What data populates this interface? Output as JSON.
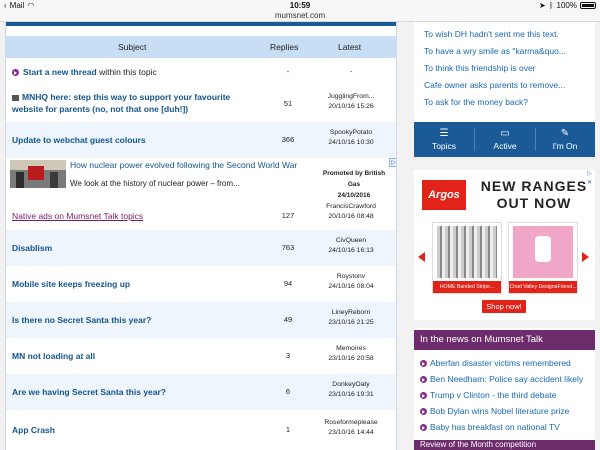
{
  "statusbar": {
    "back_label": "Mail",
    "time": "10:59",
    "battery": "100%"
  },
  "browser": {
    "url": "mumsnet.com"
  },
  "table": {
    "headers": {
      "subject": "Subject",
      "replies": "Replies",
      "latest": "Latest"
    },
    "start_thread": {
      "link": "Start a new thread",
      "suffix": "within this topic",
      "replies": "-",
      "latest": "-"
    },
    "rows": [
      {
        "subject_line1": "MNHQ here: step this way to support your favourite",
        "subject_line2": "website for parents (no, not that one [duh!])",
        "replies": "51",
        "latest_user": "JugglingFrom...",
        "latest_time": "20/10/16 15:26"
      },
      {
        "subject_line1": "Update to webchat guest colours",
        "subject_line2": "",
        "replies": "366",
        "latest_user": "SpookyPotato",
        "latest_time": "24/10/16 10:30"
      },
      {
        "subject_line1": "Native ads on Mumsnet Talk topics",
        "subject_line2": "",
        "replies": "127",
        "latest_user": "FrancisCrawford",
        "latest_time": "20/10/16 08:48"
      },
      {
        "subject_line1": "Disablism",
        "subject_line2": "",
        "replies": "763",
        "latest_user": "CivQueen",
        "latest_time": "24/10/16 16:13"
      },
      {
        "subject_line1": "Mobile site keeps freezing up",
        "subject_line2": "",
        "replies": "94",
        "latest_user": "Roystonv",
        "latest_time": "24/10/16 08:04"
      },
      {
        "subject_line1": "Is there no Secret Santa this year?",
        "subject_line2": "",
        "replies": "49",
        "latest_user": "LineyReborn",
        "latest_time": "23/10/16 21:25"
      },
      {
        "subject_line1": "MN not loading at all",
        "subject_line2": "",
        "replies": "3",
        "latest_user": "Memoires",
        "latest_time": "23/10/16 20:58"
      },
      {
        "subject_line1": "Are we having Secret Santa this year?",
        "subject_line2": "",
        "replies": "6",
        "latest_user": "DonkeyOaty",
        "latest_time": "23/10/16 19:31"
      },
      {
        "subject_line1": "App Crash",
        "subject_line2": "",
        "replies": "1",
        "latest_user": "Roseformeplease",
        "latest_time": "23/10/16 14:44"
      }
    ],
    "native_ad": {
      "headline": "How nuclear power evolved following the Second World War",
      "text": "We look at the history of nuclear power – from...",
      "promoted_by": "Promoted by",
      "sponsor": "British Gas",
      "date": "24/10/2016",
      "badge": "▷"
    }
  },
  "sidebar": {
    "links": [
      "To wish DH hadn't sent me this text.",
      "To have a wry smile as \"karma&quo...",
      "To think this friendship is over",
      "Cafe owner asks parents to remove...",
      "To ask for the money back?"
    ],
    "tabs": [
      {
        "label": "Topics",
        "icon": "list-icon"
      },
      {
        "label": "Active",
        "icon": "speech-bubble-icon"
      },
      {
        "label": "I'm On",
        "icon": "pin-icon"
      }
    ],
    "argos_ad": {
      "logo": "Argos",
      "headline_line1": "NEW RANGES",
      "headline_line2": "OUT NOW",
      "product1": "HOME Banded Stripe...",
      "product2": "Chad Valley DesignaFriend...",
      "cta": "Shop now!",
      "info_badge": "▷ ✕"
    },
    "news": {
      "heading": "In the news on Mumsnet Talk",
      "items": [
        "Aberfan disaster victims remembered",
        "Ben Needham: Police say accident likely",
        "Trump v Clinton - the third debate",
        "Bob Dylan wins Nobel literature prize",
        "Baby has breakfast on national TV"
      ],
      "next_heading": "Review of the Month competition"
    }
  }
}
